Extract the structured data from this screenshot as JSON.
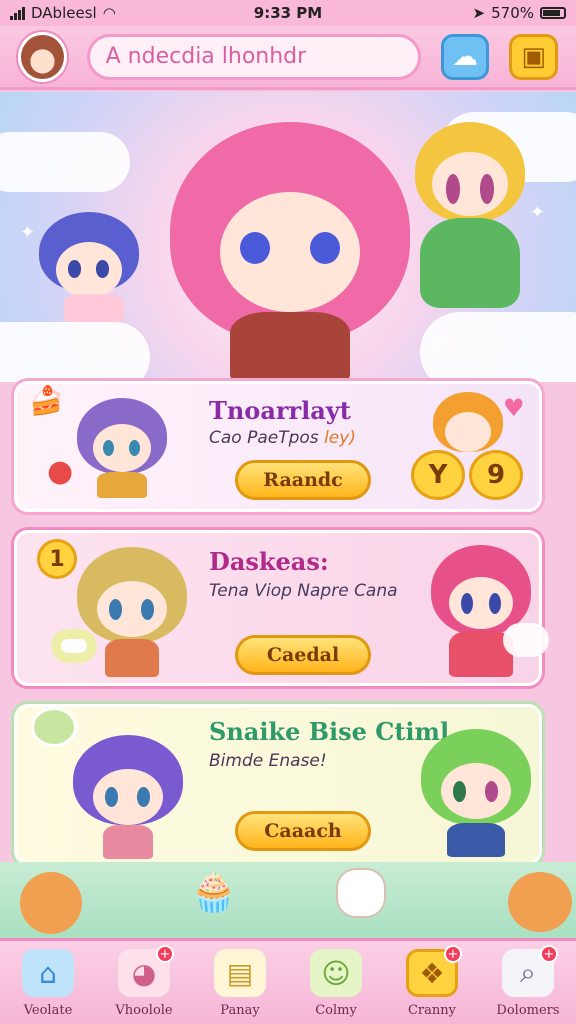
{
  "status_bar": {
    "carrier": "DAbleesl",
    "time": "9:33 PM",
    "battery": "570%"
  },
  "header": {
    "search_placeholder": "A ndecdia lhonhdr"
  },
  "cards": [
    {
      "title": "Tnoarrlayt",
      "subtitle": "Cao PaeTpos",
      "subtitle_tag": "ley)",
      "button": "Raandc",
      "extra_a": "Y",
      "extra_b": "9",
      "title_color": "#8a2aa8"
    },
    {
      "title": "Daskeas:",
      "subtitle": "Tena Viop Napre Cana",
      "button": "Caedal",
      "badge": "1",
      "title_color": "#b02a8a"
    },
    {
      "title": "Snaike Bise Ctiml",
      "subtitle": "Bimde Enase!",
      "button": "Caaach",
      "title_color": "#2e9a6a"
    }
  ],
  "nav": [
    {
      "label": "Veolate",
      "icon": "home-icon",
      "badge": ""
    },
    {
      "label": "Vhoolole",
      "icon": "pet-icon",
      "badge": "+"
    },
    {
      "label": "Panay",
      "icon": "cards-icon",
      "badge": ""
    },
    {
      "label": "Colmy",
      "icon": "friend-icon",
      "badge": ""
    },
    {
      "label": "Cranny",
      "icon": "gift-icon",
      "badge": "+"
    },
    {
      "label": "Dolomers",
      "icon": "search-icon",
      "badge": "+"
    }
  ],
  "colors": {
    "accent": "#f08cc0",
    "button": "#ffb51c"
  }
}
